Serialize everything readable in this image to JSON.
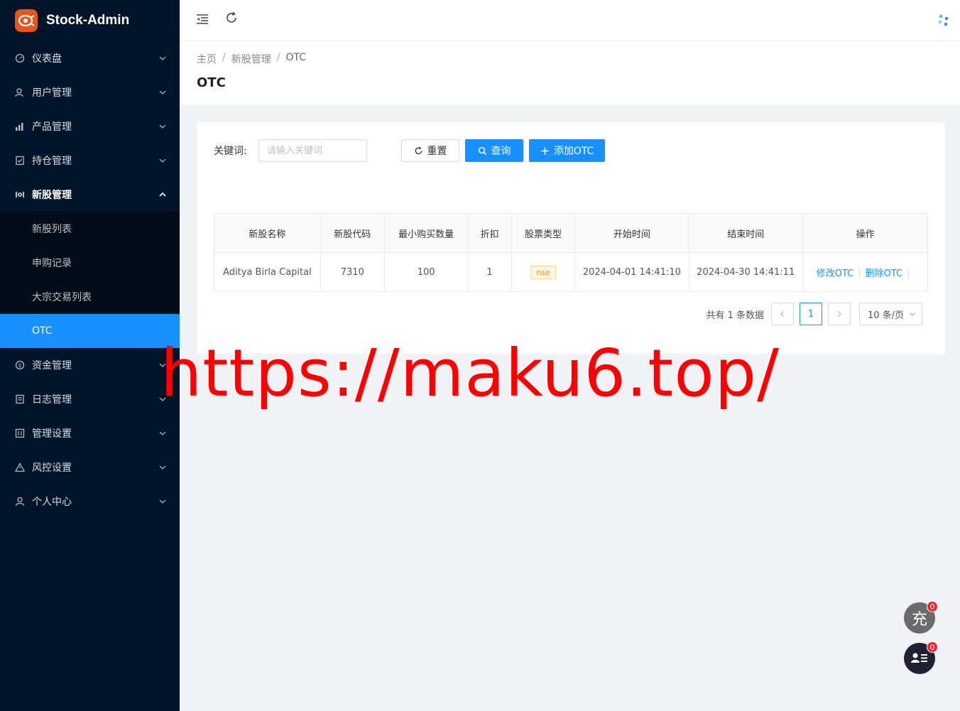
{
  "app": {
    "title": "Stock-Admin"
  },
  "sidebar": {
    "items_top": [
      {
        "label": "仪表盘",
        "icon": "dashboard-icon"
      },
      {
        "label": "用户管理",
        "icon": "users-icon"
      },
      {
        "label": "产品管理",
        "icon": "chart-icon"
      },
      {
        "label": "持仓管理",
        "icon": "position-icon"
      },
      {
        "label": "新股管理",
        "icon": "ipo-icon"
      }
    ],
    "submenu": [
      {
        "label": "新股列表"
      },
      {
        "label": "申购记录"
      },
      {
        "label": "大宗交易列表"
      },
      {
        "label": "OTC"
      }
    ],
    "items_bottom": [
      {
        "label": "资金管理",
        "icon": "money-icon"
      },
      {
        "label": "日志管理",
        "icon": "log-icon"
      },
      {
        "label": "管理设置",
        "icon": "settings-icon"
      },
      {
        "label": "风控设置",
        "icon": "warning-icon"
      },
      {
        "label": "个人中心",
        "icon": "user-icon"
      }
    ]
  },
  "breadcrumb": {
    "home": "主页",
    "parent": "新股管理",
    "current": "OTC",
    "sep": "/"
  },
  "page": {
    "title": "OTC"
  },
  "search": {
    "label": "关键词:",
    "placeholder": "请输入关键词",
    "reset": "重置",
    "query": "查询",
    "add": "添加OTC"
  },
  "table": {
    "headers": [
      "新股名称",
      "新股代码",
      "最小购买数量",
      "折扣",
      "股票类型",
      "开始时间",
      "结束时间",
      "操作"
    ],
    "rows": [
      {
        "name": "Aditya Birla Capital",
        "code": "7310",
        "min_qty": "100",
        "discount": "1",
        "type": "nse",
        "start": "2024-04-01 14:41:10",
        "end": "2024-04-30 14:41:11",
        "edit": "修改OTC",
        "delete": "删除OTC"
      }
    ]
  },
  "pagination": {
    "total": "共有 1 条数据",
    "page": "1",
    "size": "10 条/页"
  },
  "watermark": "https://maku6.top/",
  "floating": {
    "charge": "充",
    "charge_badge": "0",
    "chat_badge": "0"
  },
  "colors": {
    "sidebar_bg": "#001529",
    "active": "#1890ff",
    "watermark": "#ff0000"
  }
}
